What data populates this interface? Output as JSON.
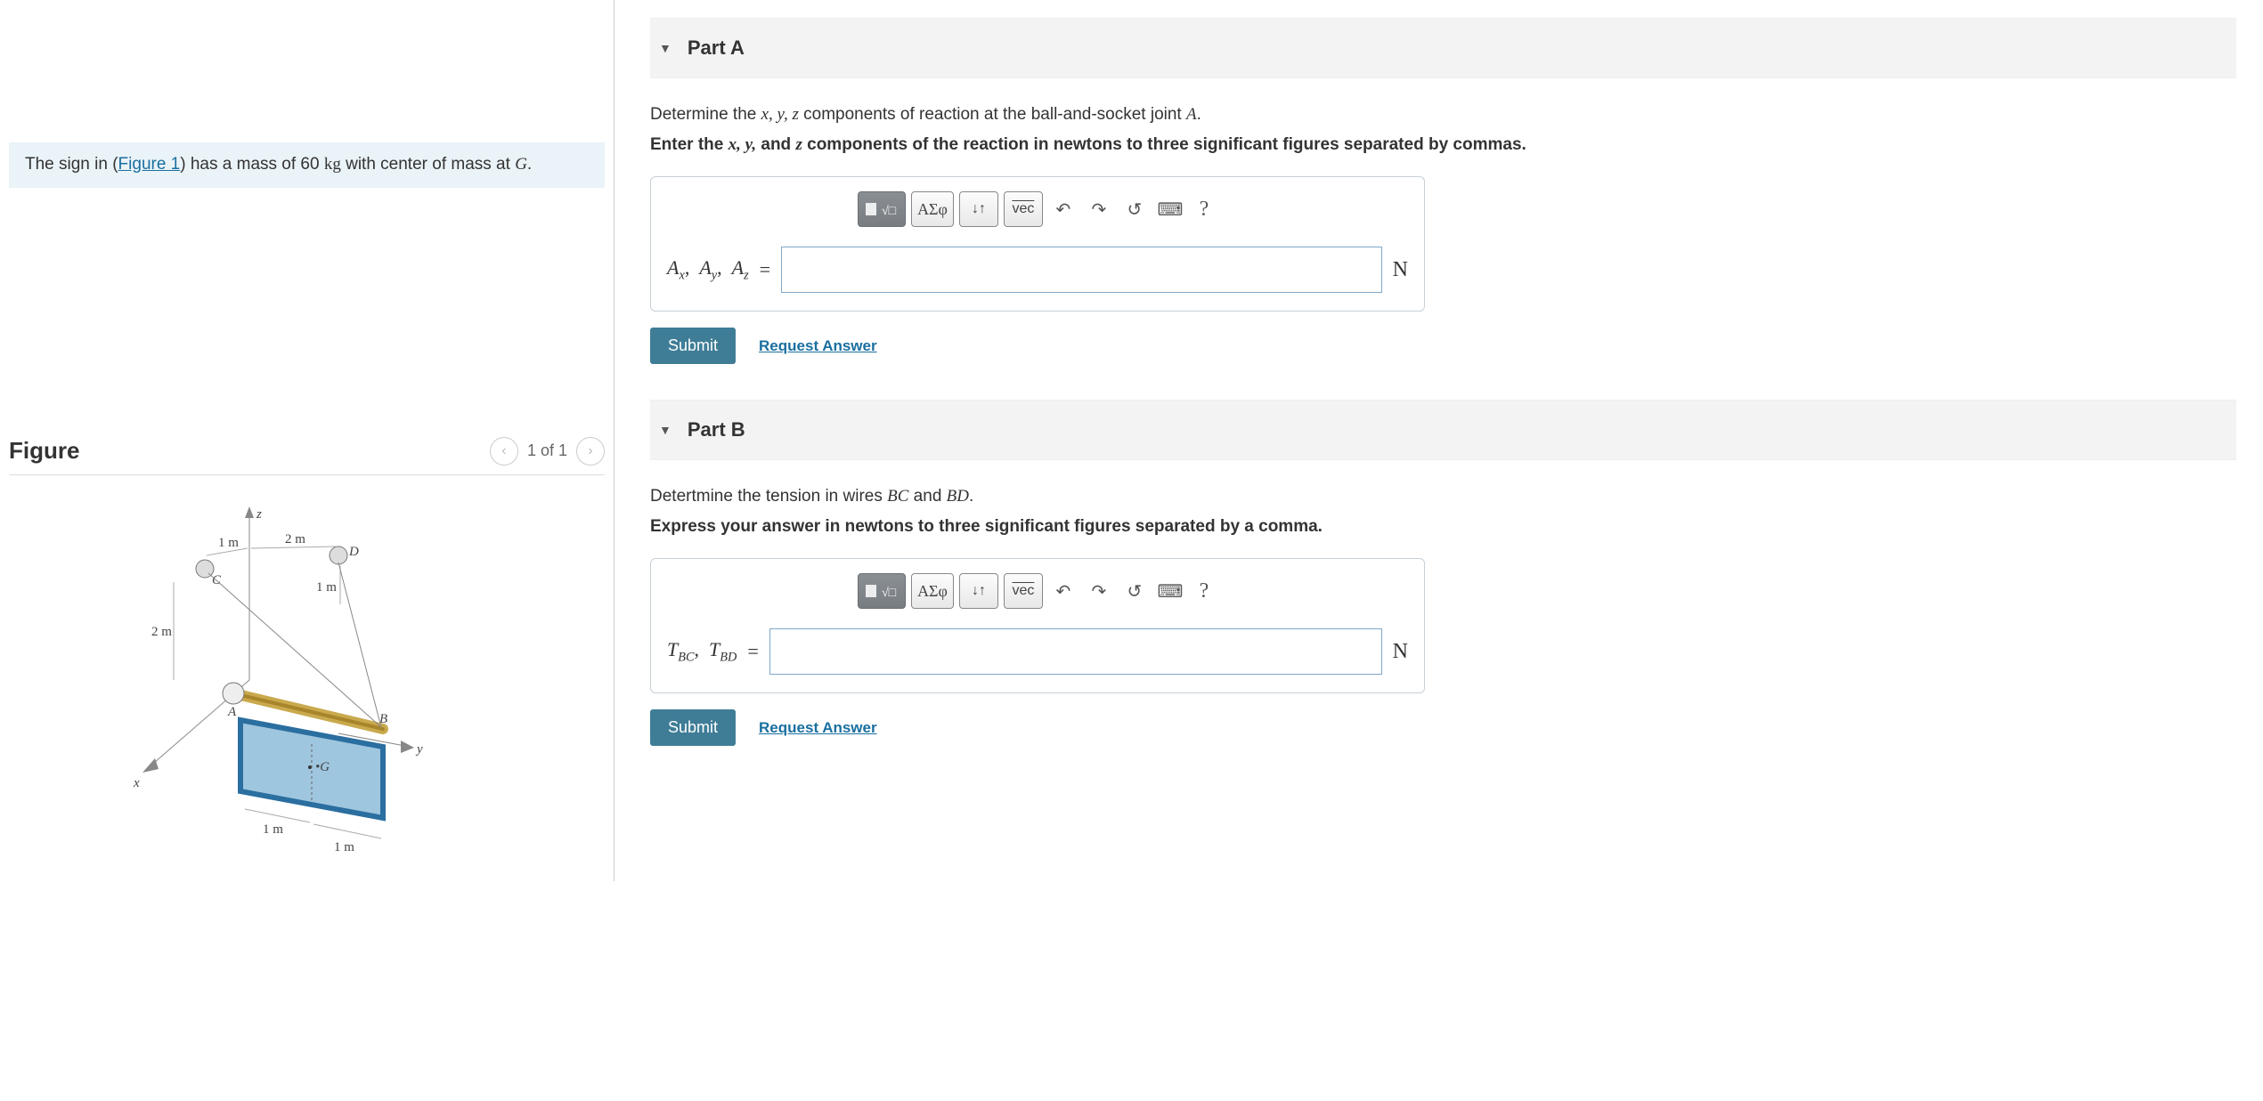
{
  "problem": {
    "prefix": "The sign in (",
    "figure_link": "Figure 1",
    "mid": ") has a mass of 60 ",
    "mass_unit": "kg",
    "tail": " with center of mass at ",
    "g_var": "G",
    "period": "."
  },
  "figure": {
    "title": "Figure",
    "pager": "1 of 1",
    "labels": {
      "z": "z",
      "x": "x",
      "y": "y",
      "A": "A",
      "B": "B",
      "C": "C",
      "D": "D",
      "G": "G",
      "d_1m_a": "1 m",
      "d_1m_b": "1 m",
      "d_1m_c": "1 m",
      "d_1m_d": "1 m",
      "d_2m_a": "2 m",
      "d_2m_b": "2 m"
    }
  },
  "partA": {
    "title": "Part A",
    "question_pre": "Determine the ",
    "vars": "x, y, z",
    "question_mid": " components of reaction at the ball-and-socket joint ",
    "joint": "A",
    "question_post": ".",
    "instruction_pre": "Enter the ",
    "instruction_vars": "x, y,",
    "instruction_and": " and ",
    "instruction_z": "z",
    "instruction_post": " components of the reaction in newtons to three significant figures separated by commas.",
    "lhs_vars": "Aₓ,  A_y,  A_z",
    "unit": "N",
    "submit": "Submit",
    "request": "Request Answer"
  },
  "partB": {
    "title": "Part B",
    "question_pre": "Detertmine the tension in wires ",
    "bc": "BC",
    "and": " and ",
    "bd": "BD",
    "period": ".",
    "instruction": "Express your answer in newtons to three significant figures separated by a comma.",
    "unit": "N",
    "submit": "Submit",
    "request": "Request Answer"
  },
  "toolbar": {
    "greek": "ΑΣφ",
    "vec": "vec"
  }
}
